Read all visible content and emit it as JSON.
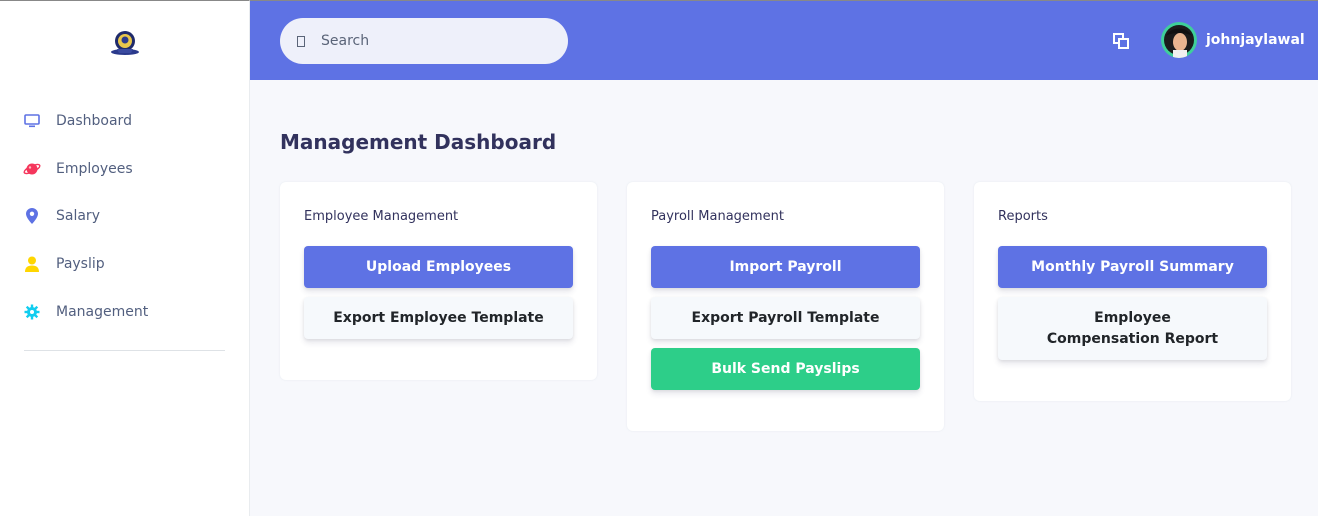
{
  "sidebar": {
    "items": [
      {
        "label": "Dashboard",
        "icon": "monitor-icon",
        "color": "#5e72e4"
      },
      {
        "label": "Employees",
        "icon": "planet-icon",
        "color": "#f5365c"
      },
      {
        "label": "Salary",
        "icon": "map-pin-icon",
        "color": "#5e72e4"
      },
      {
        "label": "Payslip",
        "icon": "user-icon",
        "color": "#ffd600"
      },
      {
        "label": "Management",
        "icon": "gear-icon",
        "color": "#11cdef"
      }
    ]
  },
  "header": {
    "search_placeholder": "Search",
    "username": "johnjaylawal"
  },
  "main": {
    "title": "Management Dashboard",
    "cards": [
      {
        "title": "Employee Management",
        "buttons": [
          "Upload Employees",
          "Export Employee Template"
        ]
      },
      {
        "title": "Payroll Management",
        "buttons": [
          "Import Payroll",
          "Export Payroll Template",
          "Bulk Send Payslips"
        ]
      },
      {
        "title": "Reports",
        "buttons": [
          "Monthly Payroll Summary",
          "Employee Compensation Report"
        ]
      }
    ]
  },
  "colors": {
    "primary": "#5e72e4",
    "success": "#2dce89",
    "light": "#f6f9fc"
  }
}
